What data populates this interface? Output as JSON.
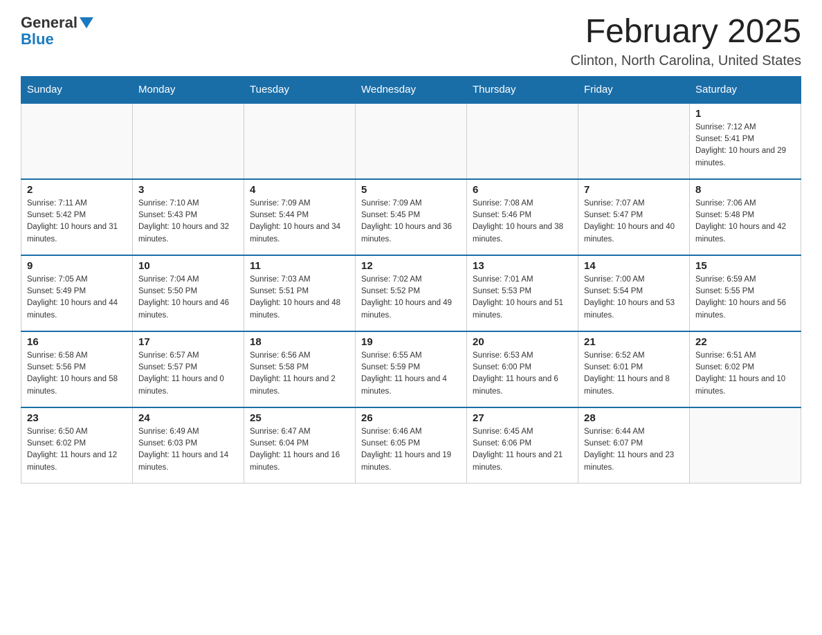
{
  "header": {
    "logo_general": "General",
    "logo_blue": "Blue",
    "month_title": "February 2025",
    "location": "Clinton, North Carolina, United States"
  },
  "days_of_week": [
    "Sunday",
    "Monday",
    "Tuesday",
    "Wednesday",
    "Thursday",
    "Friday",
    "Saturday"
  ],
  "weeks": [
    [
      {
        "day": "",
        "sunrise": "",
        "sunset": "",
        "daylight": ""
      },
      {
        "day": "",
        "sunrise": "",
        "sunset": "",
        "daylight": ""
      },
      {
        "day": "",
        "sunrise": "",
        "sunset": "",
        "daylight": ""
      },
      {
        "day": "",
        "sunrise": "",
        "sunset": "",
        "daylight": ""
      },
      {
        "day": "",
        "sunrise": "",
        "sunset": "",
        "daylight": ""
      },
      {
        "day": "",
        "sunrise": "",
        "sunset": "",
        "daylight": ""
      },
      {
        "day": "1",
        "sunrise": "Sunrise: 7:12 AM",
        "sunset": "Sunset: 5:41 PM",
        "daylight": "Daylight: 10 hours and 29 minutes."
      }
    ],
    [
      {
        "day": "2",
        "sunrise": "Sunrise: 7:11 AM",
        "sunset": "Sunset: 5:42 PM",
        "daylight": "Daylight: 10 hours and 31 minutes."
      },
      {
        "day": "3",
        "sunrise": "Sunrise: 7:10 AM",
        "sunset": "Sunset: 5:43 PM",
        "daylight": "Daylight: 10 hours and 32 minutes."
      },
      {
        "day": "4",
        "sunrise": "Sunrise: 7:09 AM",
        "sunset": "Sunset: 5:44 PM",
        "daylight": "Daylight: 10 hours and 34 minutes."
      },
      {
        "day": "5",
        "sunrise": "Sunrise: 7:09 AM",
        "sunset": "Sunset: 5:45 PM",
        "daylight": "Daylight: 10 hours and 36 minutes."
      },
      {
        "day": "6",
        "sunrise": "Sunrise: 7:08 AM",
        "sunset": "Sunset: 5:46 PM",
        "daylight": "Daylight: 10 hours and 38 minutes."
      },
      {
        "day": "7",
        "sunrise": "Sunrise: 7:07 AM",
        "sunset": "Sunset: 5:47 PM",
        "daylight": "Daylight: 10 hours and 40 minutes."
      },
      {
        "day": "8",
        "sunrise": "Sunrise: 7:06 AM",
        "sunset": "Sunset: 5:48 PM",
        "daylight": "Daylight: 10 hours and 42 minutes."
      }
    ],
    [
      {
        "day": "9",
        "sunrise": "Sunrise: 7:05 AM",
        "sunset": "Sunset: 5:49 PM",
        "daylight": "Daylight: 10 hours and 44 minutes."
      },
      {
        "day": "10",
        "sunrise": "Sunrise: 7:04 AM",
        "sunset": "Sunset: 5:50 PM",
        "daylight": "Daylight: 10 hours and 46 minutes."
      },
      {
        "day": "11",
        "sunrise": "Sunrise: 7:03 AM",
        "sunset": "Sunset: 5:51 PM",
        "daylight": "Daylight: 10 hours and 48 minutes."
      },
      {
        "day": "12",
        "sunrise": "Sunrise: 7:02 AM",
        "sunset": "Sunset: 5:52 PM",
        "daylight": "Daylight: 10 hours and 49 minutes."
      },
      {
        "day": "13",
        "sunrise": "Sunrise: 7:01 AM",
        "sunset": "Sunset: 5:53 PM",
        "daylight": "Daylight: 10 hours and 51 minutes."
      },
      {
        "day": "14",
        "sunrise": "Sunrise: 7:00 AM",
        "sunset": "Sunset: 5:54 PM",
        "daylight": "Daylight: 10 hours and 53 minutes."
      },
      {
        "day": "15",
        "sunrise": "Sunrise: 6:59 AM",
        "sunset": "Sunset: 5:55 PM",
        "daylight": "Daylight: 10 hours and 56 minutes."
      }
    ],
    [
      {
        "day": "16",
        "sunrise": "Sunrise: 6:58 AM",
        "sunset": "Sunset: 5:56 PM",
        "daylight": "Daylight: 10 hours and 58 minutes."
      },
      {
        "day": "17",
        "sunrise": "Sunrise: 6:57 AM",
        "sunset": "Sunset: 5:57 PM",
        "daylight": "Daylight: 11 hours and 0 minutes."
      },
      {
        "day": "18",
        "sunrise": "Sunrise: 6:56 AM",
        "sunset": "Sunset: 5:58 PM",
        "daylight": "Daylight: 11 hours and 2 minutes."
      },
      {
        "day": "19",
        "sunrise": "Sunrise: 6:55 AM",
        "sunset": "Sunset: 5:59 PM",
        "daylight": "Daylight: 11 hours and 4 minutes."
      },
      {
        "day": "20",
        "sunrise": "Sunrise: 6:53 AM",
        "sunset": "Sunset: 6:00 PM",
        "daylight": "Daylight: 11 hours and 6 minutes."
      },
      {
        "day": "21",
        "sunrise": "Sunrise: 6:52 AM",
        "sunset": "Sunset: 6:01 PM",
        "daylight": "Daylight: 11 hours and 8 minutes."
      },
      {
        "day": "22",
        "sunrise": "Sunrise: 6:51 AM",
        "sunset": "Sunset: 6:02 PM",
        "daylight": "Daylight: 11 hours and 10 minutes."
      }
    ],
    [
      {
        "day": "23",
        "sunrise": "Sunrise: 6:50 AM",
        "sunset": "Sunset: 6:02 PM",
        "daylight": "Daylight: 11 hours and 12 minutes."
      },
      {
        "day": "24",
        "sunrise": "Sunrise: 6:49 AM",
        "sunset": "Sunset: 6:03 PM",
        "daylight": "Daylight: 11 hours and 14 minutes."
      },
      {
        "day": "25",
        "sunrise": "Sunrise: 6:47 AM",
        "sunset": "Sunset: 6:04 PM",
        "daylight": "Daylight: 11 hours and 16 minutes."
      },
      {
        "day": "26",
        "sunrise": "Sunrise: 6:46 AM",
        "sunset": "Sunset: 6:05 PM",
        "daylight": "Daylight: 11 hours and 19 minutes."
      },
      {
        "day": "27",
        "sunrise": "Sunrise: 6:45 AM",
        "sunset": "Sunset: 6:06 PM",
        "daylight": "Daylight: 11 hours and 21 minutes."
      },
      {
        "day": "28",
        "sunrise": "Sunrise: 6:44 AM",
        "sunset": "Sunset: 6:07 PM",
        "daylight": "Daylight: 11 hours and 23 minutes."
      },
      {
        "day": "",
        "sunrise": "",
        "sunset": "",
        "daylight": ""
      }
    ]
  ]
}
